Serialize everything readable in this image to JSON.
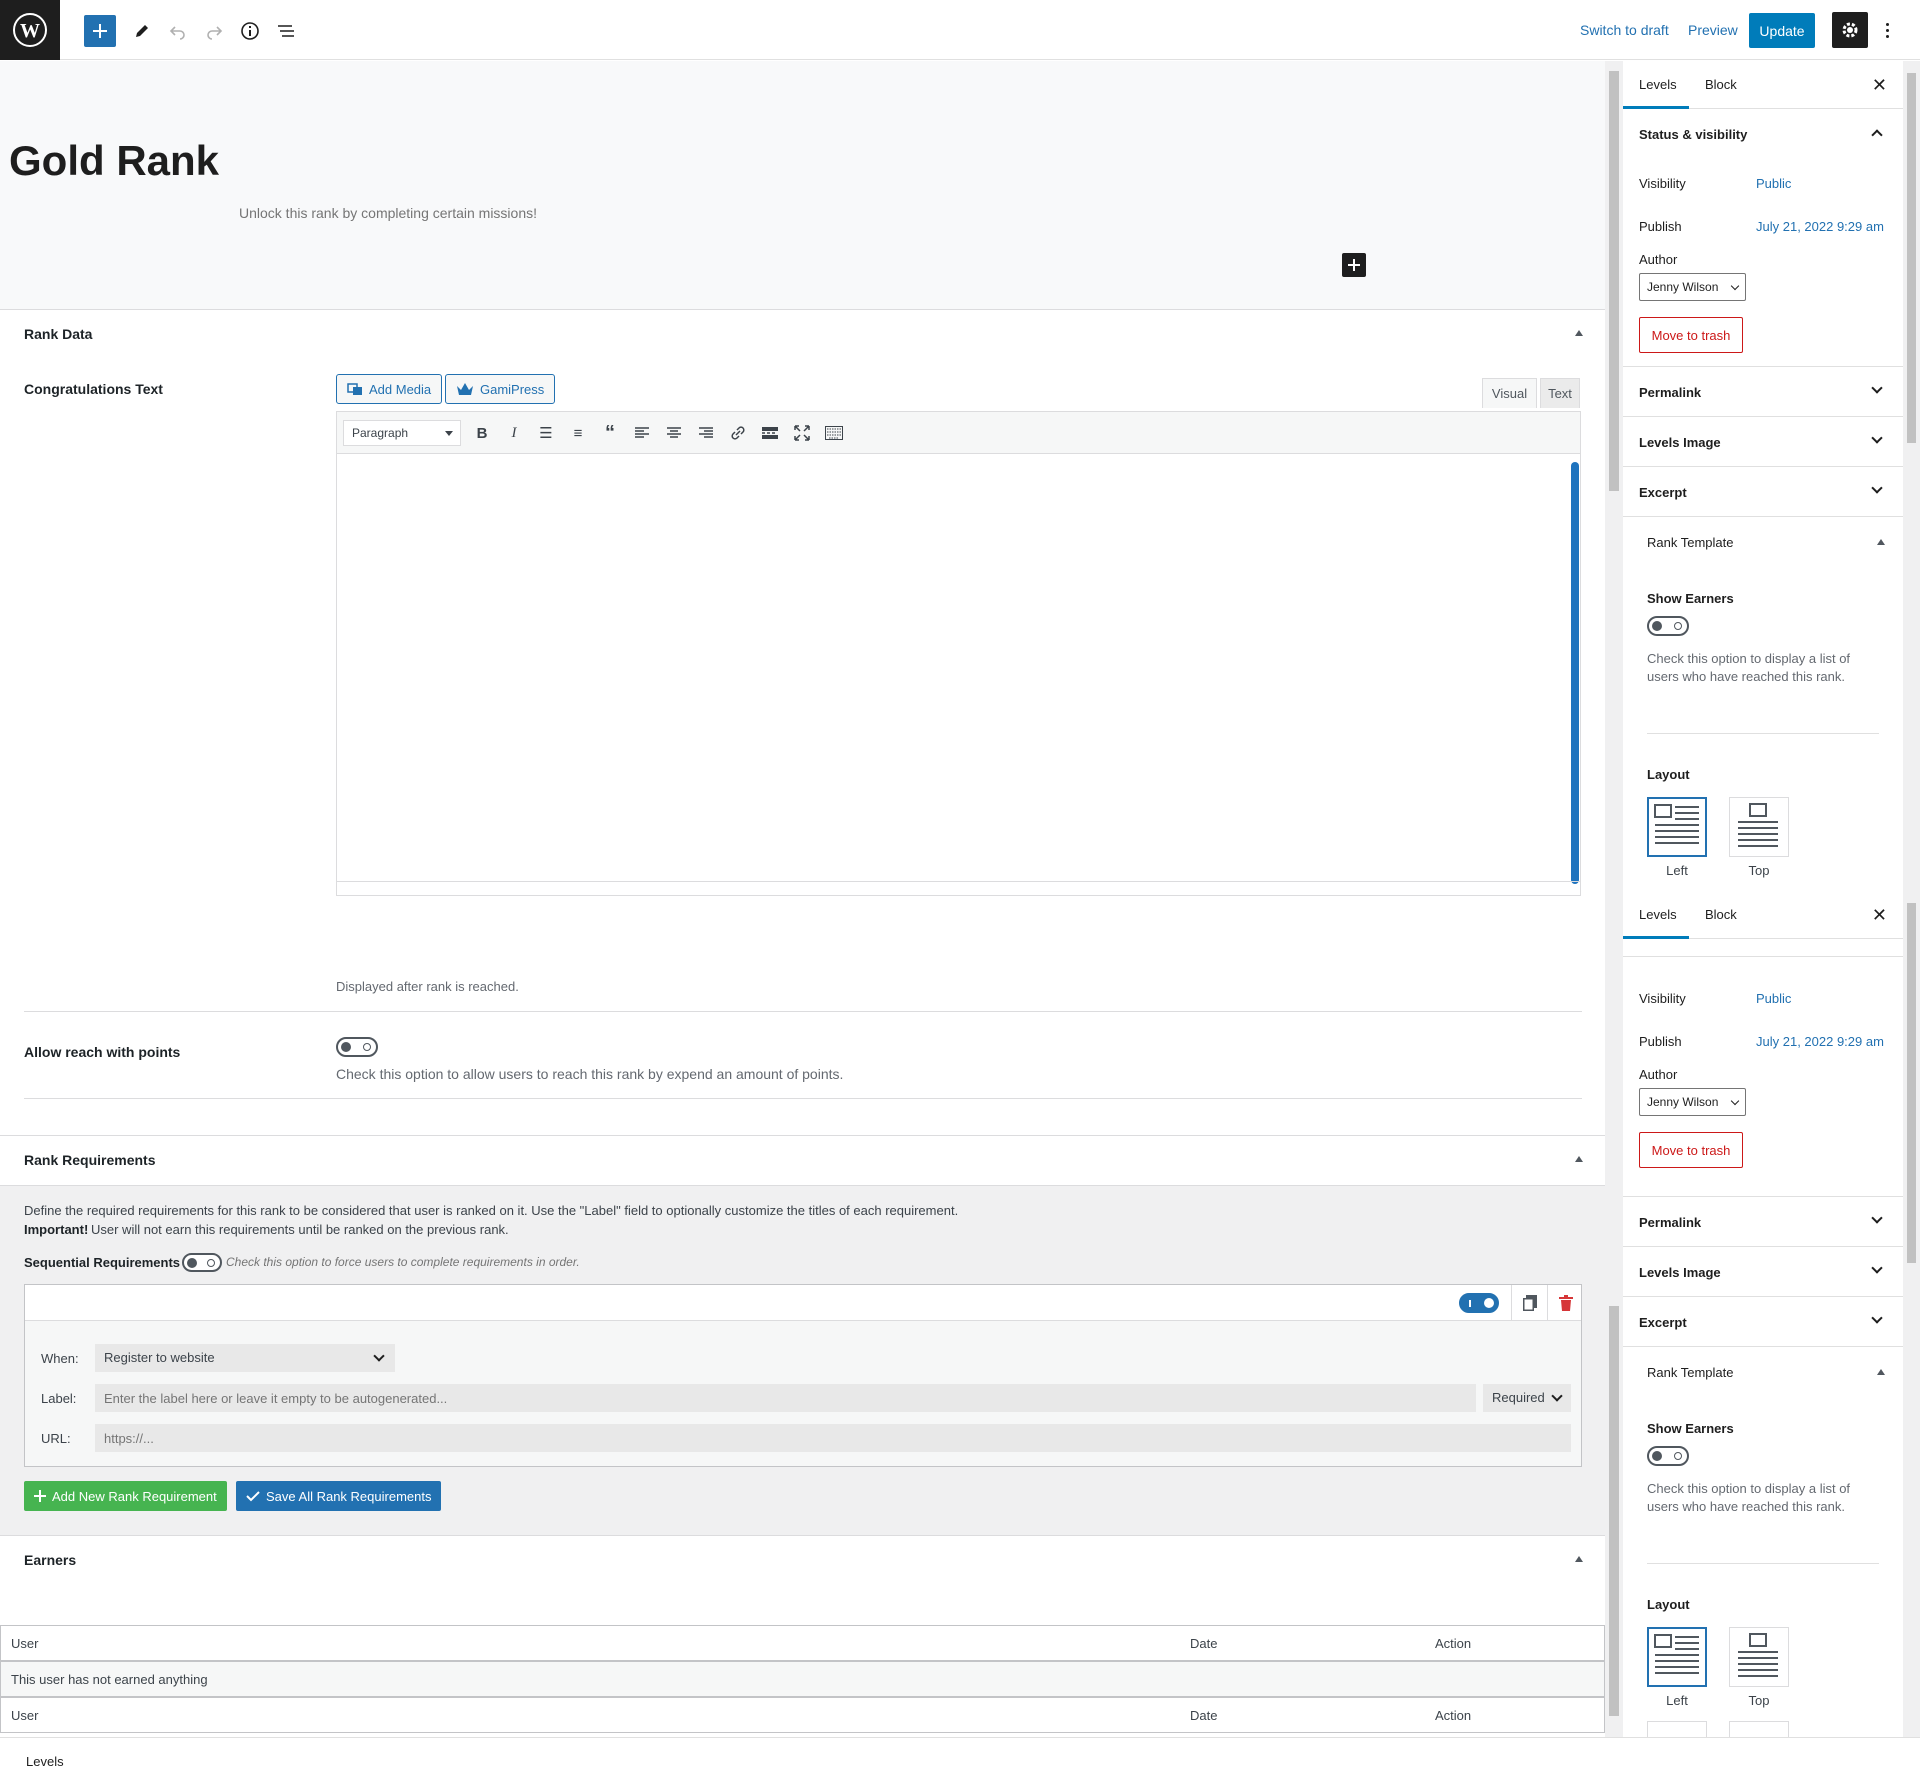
{
  "toolbar": {
    "switch_to_draft": "Switch to draft",
    "preview": "Preview",
    "update": "Update"
  },
  "post": {
    "title": "Gold Rank",
    "subtitle": "Unlock this rank by completing certain missions!"
  },
  "rank_data": {
    "title": "Rank Data",
    "congrats_label": "Congratulations Text",
    "add_media": "Add Media",
    "gamipress": "GamiPress",
    "tab_visual": "Visual",
    "tab_text": "Text",
    "format_select": "Paragraph",
    "editor_hint": "Displayed after rank is reached.",
    "allow_label": "Allow reach with points",
    "allow_hint": "Check this option to allow users to reach this rank by expend an amount of points."
  },
  "rank_requirements": {
    "title": "Rank Requirements",
    "desc_line1": "Define the required requirements for this rank to be considered that user is ranked on it. Use the \"Label\" field to optionally customize the titles of each requirement.",
    "important_label": "Important!",
    "desc_line2": "User will not earn this requirements until be ranked on the previous rank.",
    "sequential_label": "Sequential Requirements",
    "sequential_hint": "Check this option to force users to complete requirements in order.",
    "when_label": "When:",
    "when_value": "Register to website",
    "label_label": "Label:",
    "label_placeholder": "Enter the label here or leave it empty to be autogenerated...",
    "required_value": "Required",
    "url_label": "URL:",
    "url_placeholder": "https://...",
    "add_new": "Add New Rank Requirement",
    "save_all": "Save All Rank Requirements"
  },
  "earners": {
    "title": "Earners",
    "col_user": "User",
    "col_date": "Date",
    "col_action": "Action",
    "empty": "This user has not earned anything"
  },
  "sidebar": {
    "tab_levels": "Levels",
    "tab_block": "Block",
    "status_title": "Status & visibility",
    "visibility_label": "Visibility",
    "visibility_value": "Public",
    "publish_label": "Publish",
    "publish_value": "July 21, 2022 9:29 am",
    "author_label": "Author",
    "author_value": "Jenny Wilson",
    "trash": "Move to trash",
    "permalink": "Permalink",
    "levels_image": "Levels Image",
    "excerpt": "Excerpt",
    "rank_template": "Rank Template",
    "show_earners": "Show Earners",
    "show_earners_hint_1": "Check this option to display a list of",
    "show_earners_hint_2": "users who have reached this rank.",
    "layout": "Layout",
    "layout_left": "Left",
    "layout_top": "Top"
  },
  "footer": {
    "breadcrumb": "Levels"
  }
}
